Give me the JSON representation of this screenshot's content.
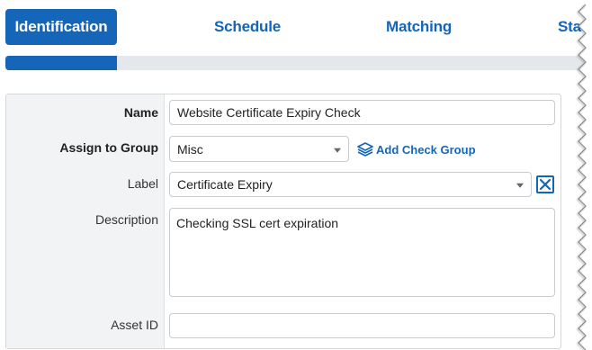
{
  "tabs": [
    {
      "label": "Identification",
      "active": true
    },
    {
      "label": "Schedule",
      "active": false
    },
    {
      "label": "Matching",
      "active": false
    },
    {
      "label": "Stat",
      "active": false
    }
  ],
  "progress": {
    "fraction": 0.19
  },
  "form": {
    "name": {
      "label": "Name",
      "value": "Website Certificate Expiry Check"
    },
    "group": {
      "label": "Assign to Group",
      "value": "Misc",
      "add_label": "Add Check Group"
    },
    "label": {
      "label": "Label",
      "value": "Certificate Expiry"
    },
    "description": {
      "label": "Description",
      "value": "Checking SSL cert expiration"
    },
    "asset": {
      "label": "Asset ID",
      "value": ""
    }
  },
  "colors": {
    "accent": "#1565b8",
    "label_bg": "#f1f3f5",
    "border": "#c8ccd0"
  },
  "icons": {
    "add_group": "layers-icon",
    "clear": "close-box-icon",
    "dropdown": "chevron-down-icon"
  }
}
